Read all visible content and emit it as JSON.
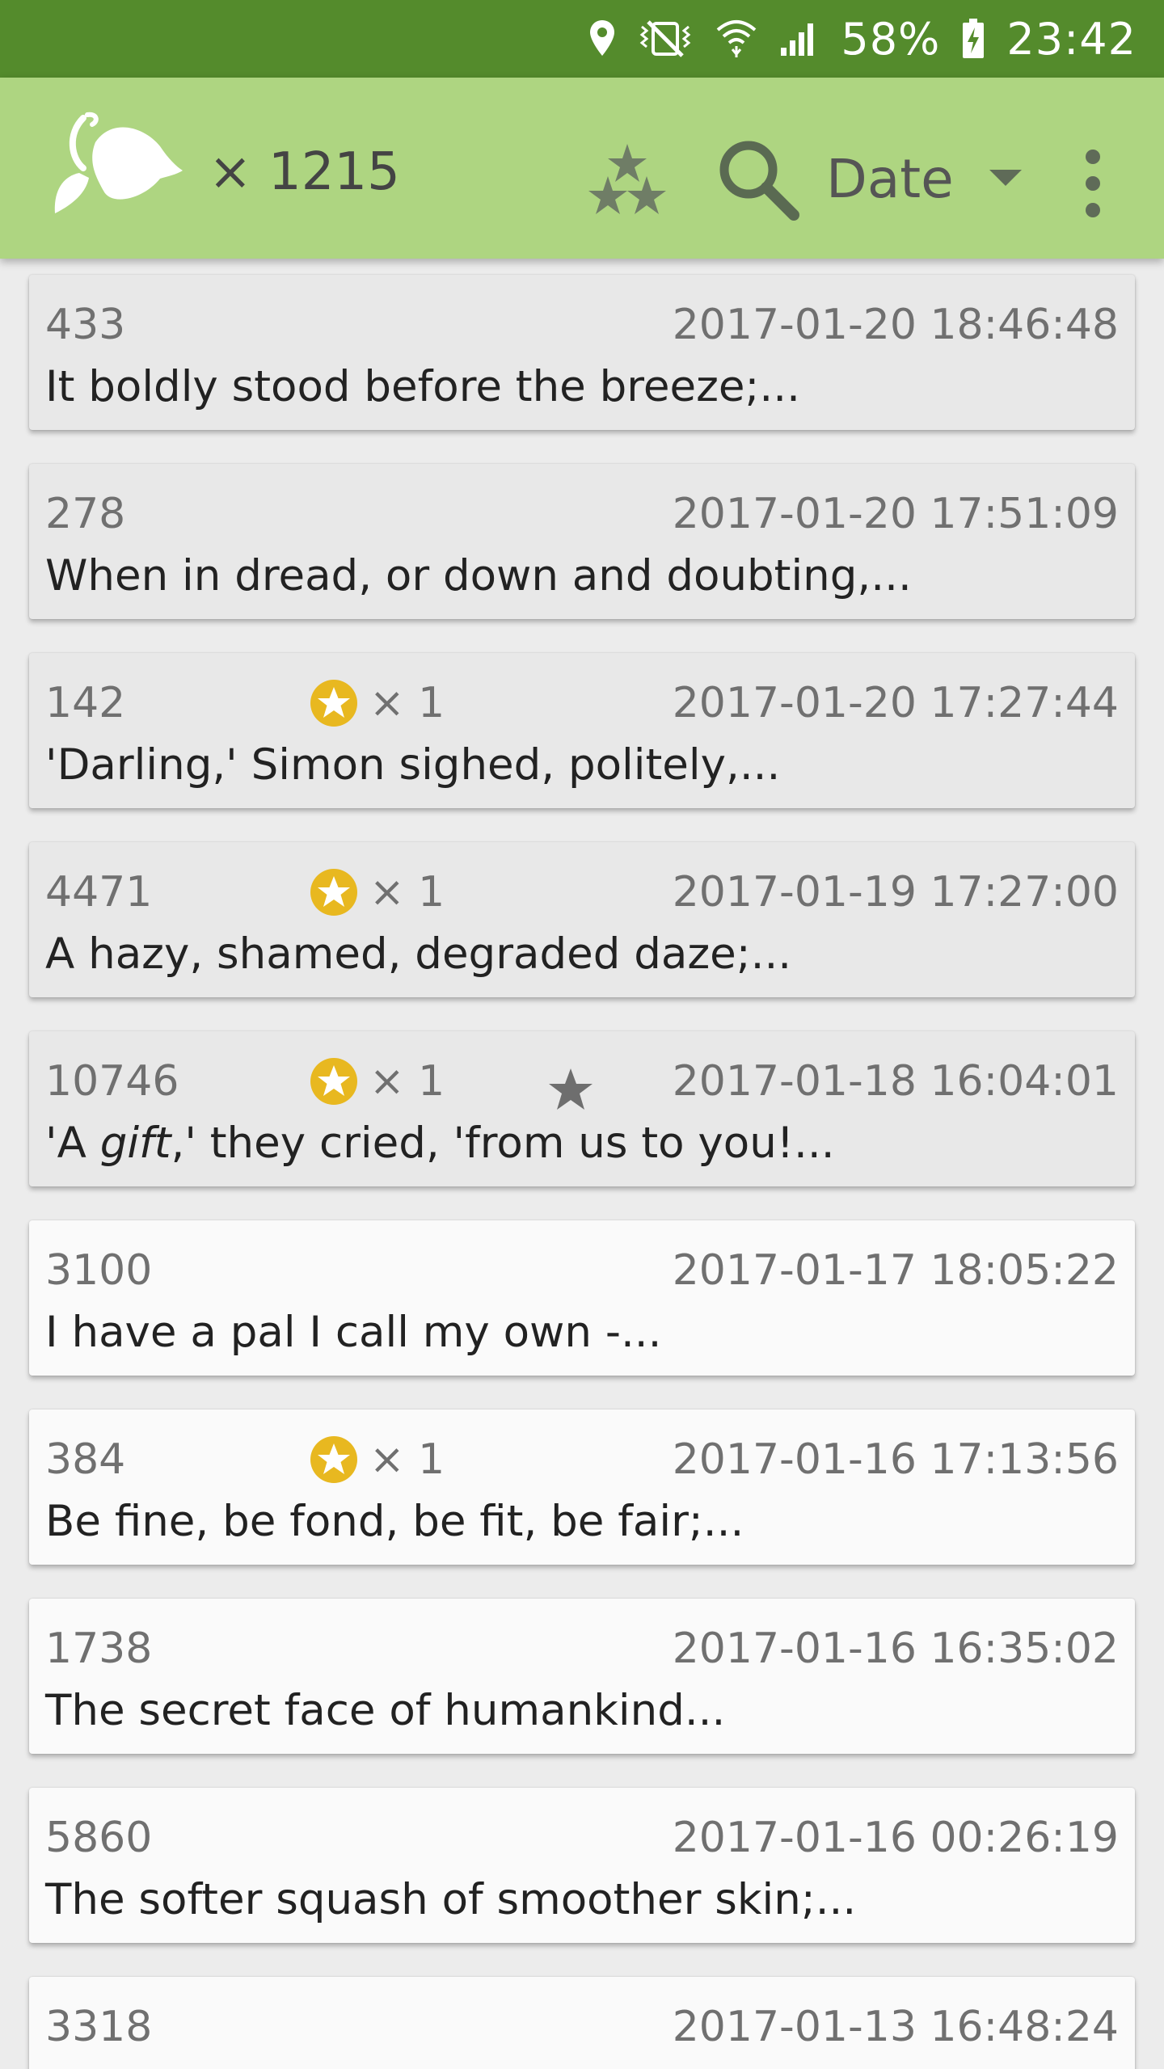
{
  "status_bar": {
    "battery": "58%",
    "time": "23:42"
  },
  "app_bar": {
    "count": "× 1215",
    "sort": {
      "selected": "Date"
    }
  },
  "colors": {
    "status_bar": "#548b2c",
    "app_bar": "#aed581",
    "award_gold": "#e8b820",
    "card_read": "#e8e8e8",
    "card_unread": "#fafafa"
  },
  "entries": [
    {
      "id": "433",
      "date": "2017-01-20 18:46:48",
      "text": "It boldly stood before the breeze;...",
      "award": null,
      "favorite": false,
      "read": true
    },
    {
      "id": "278",
      "date": "2017-01-20 17:51:09",
      "text": "When in dread, or down and doubting,...",
      "award": null,
      "favorite": false,
      "read": true
    },
    {
      "id": "142",
      "date": "2017-01-20 17:27:44",
      "text": "'Darling,' Simon sighed, politely,...",
      "award": "× 1",
      "favorite": false,
      "read": true
    },
    {
      "id": "4471",
      "date": "2017-01-19 17:27:00",
      "text": "A hazy, shamed, degraded daze;...",
      "award": "× 1",
      "favorite": false,
      "read": true
    },
    {
      "id": "10746",
      "date": "2017-01-18 16:04:01",
      "text_pre": "'A ",
      "text_em": "gift",
      "text_post": ",' they cried, 'from us to you!...",
      "award": "× 1",
      "favorite": true,
      "read": true
    },
    {
      "id": "3100",
      "date": "2017-01-17 18:05:22",
      "text": "I have a pal I call my own -...",
      "award": null,
      "favorite": false,
      "read": false
    },
    {
      "id": "384",
      "date": "2017-01-16 17:13:56",
      "text": "Be fine, be fond, be fit, be fair;...",
      "award": "× 1",
      "favorite": false,
      "read": false
    },
    {
      "id": "1738",
      "date": "2017-01-16 16:35:02",
      "text": "The secret face of humankind...",
      "award": null,
      "favorite": false,
      "read": false
    },
    {
      "id": "5860",
      "date": "2017-01-16 00:26:19",
      "text": "The softer squash of smoother skin;...",
      "award": null,
      "favorite": false,
      "read": false
    },
    {
      "id": "3318",
      "date": "2017-01-13 16:48:24",
      "text": "",
      "award": null,
      "favorite": false,
      "read": false
    }
  ],
  "icons": {
    "logo": "heart-sprout-logo-icon",
    "awards_filter": "three-stars-icon",
    "search": "search-icon",
    "dropdown": "triangle-down-icon",
    "overflow": "more-vert-icon",
    "award": "gold-star-badge-icon",
    "favorite": "star-icon"
  }
}
